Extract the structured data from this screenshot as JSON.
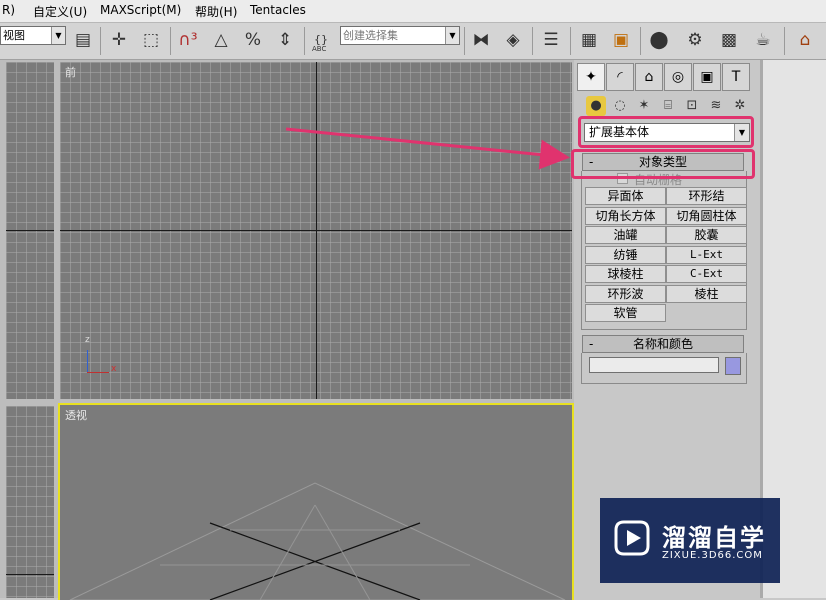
{
  "menu": {
    "items": [
      "R)",
      "自定义(U)",
      "MAXScript(M)",
      "帮助(H)",
      "Tentacles"
    ]
  },
  "toolbar": {
    "view_select_value": "视图",
    "selection_set_placeholder": "创建选择集",
    "abc_label": "ABC"
  },
  "viewports": {
    "front_label": "前",
    "perspective_label": "透视",
    "axis_z": "z",
    "axis_x": "x"
  },
  "command_panel": {
    "tabs": [
      "create-tab",
      "modify-tab",
      "hierarchy-tab",
      "motion-tab",
      "display-tab",
      "utilities-tab"
    ],
    "category_select_value": "扩展基本体",
    "object_type": {
      "title": "对象类型",
      "collapse_symbol": "-",
      "autogrid_label": "自动栅格",
      "buttons": [
        "异面体",
        "环形结",
        "切角长方体",
        "切角圆柱体",
        "油罐",
        "胶囊",
        "纺锤",
        "L-Ext",
        "球棱柱",
        "C-Ext",
        "环形波",
        "棱柱",
        "软管"
      ]
    },
    "name_color": {
      "title": "名称和颜色",
      "collapse_symbol": "-",
      "name_value": "",
      "swatch_color": "#9898e0"
    }
  },
  "colors": {
    "highlight_annotation": "#e0336e",
    "active_viewport_border": "#e8e020",
    "watermark_bg": "#102356"
  },
  "watermark": {
    "brand": "溜溜自学",
    "url": "ZIXUE.3D66.COM"
  }
}
